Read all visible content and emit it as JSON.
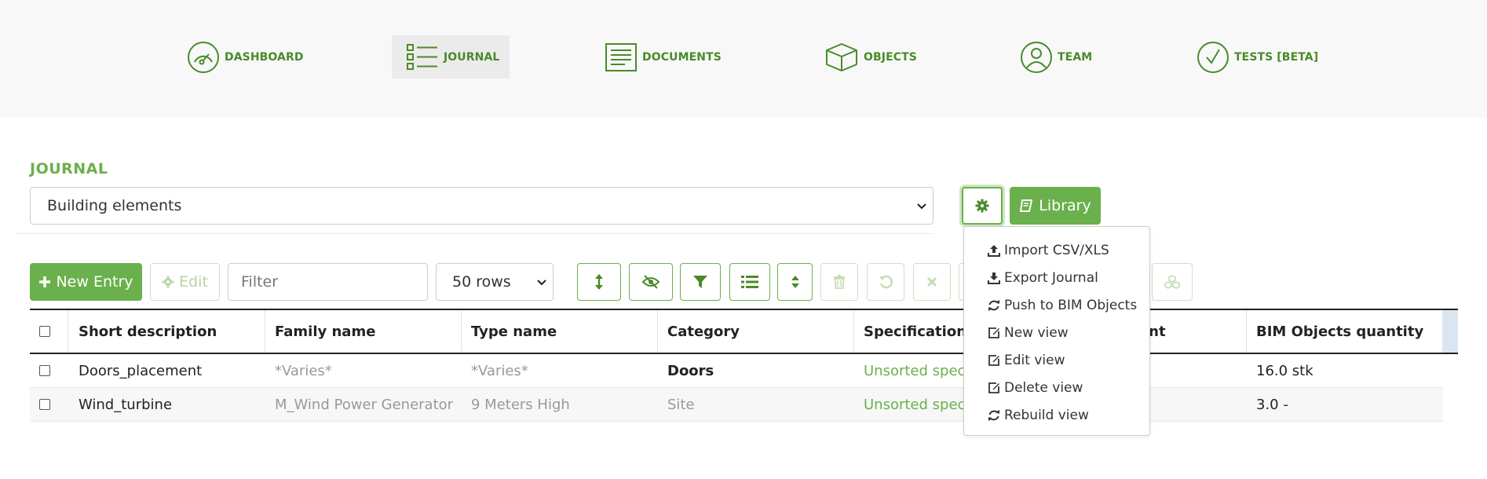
{
  "nav": [
    {
      "label": "DASHBOARD",
      "icon": "speedometer-icon",
      "active": false
    },
    {
      "label": "JOURNAL",
      "icon": "checklist-icon",
      "active": true
    },
    {
      "label": "DOCUMENTS",
      "icon": "document-icon",
      "active": false
    },
    {
      "label": "OBJECTS",
      "icon": "cube-icon",
      "active": false
    },
    {
      "label": "TEAM",
      "icon": "user-icon",
      "active": false
    },
    {
      "label": "TESTS [BETA]",
      "icon": "check-circle-icon",
      "active": false
    }
  ],
  "journal": {
    "title": "JOURNAL",
    "view_select": "Building elements",
    "library_label": "Library"
  },
  "toolbar": {
    "new_entry_label": "New Entry",
    "edit_label": "Edit",
    "filter_placeholder": "Filter",
    "rows_select": "50 rows",
    "icon_buttons": [
      "expand-vertical-icon",
      "eye-slash-icon",
      "filter-icon",
      "list-icon",
      "sort-icon",
      "trash-icon",
      "undo-icon",
      "close-icon",
      "blank",
      "cubes-icon"
    ]
  },
  "table": {
    "headers": [
      "Short description",
      "Family name",
      "Type name",
      "Category",
      "Specifications",
      "ount",
      "BIM Objects quantity"
    ],
    "rows": [
      {
        "short": "Doors_placement",
        "family": "*Varies*",
        "type": "*Varies*",
        "category": "Doors",
        "spec": "Unsorted specifi",
        "qty": "16.0 stk"
      },
      {
        "short": "Wind_turbine",
        "family": "M_Wind Power Generator",
        "type": "9 Meters High",
        "category": "Site",
        "spec": "Unsorted specifi",
        "qty": "3.0 -"
      }
    ]
  },
  "dropdown": {
    "items": [
      {
        "label": "Import CSV/XLS",
        "icon": "upload-icon"
      },
      {
        "label": "Export Journal",
        "icon": "download-icon"
      },
      {
        "label": "Push to BIM Objects",
        "icon": "refresh-icon"
      },
      {
        "label": "New view",
        "icon": "edit-icon"
      },
      {
        "label": "Edit view",
        "icon": "edit-icon"
      },
      {
        "label": "Delete view",
        "icon": "edit-icon"
      },
      {
        "label": "Rebuild view",
        "icon": "refresh-icon"
      }
    ]
  },
  "colors": {
    "brand_green": "#6ab04c",
    "nav_green": "#4a8a2a",
    "disabled_green": "#b6d6a2"
  }
}
